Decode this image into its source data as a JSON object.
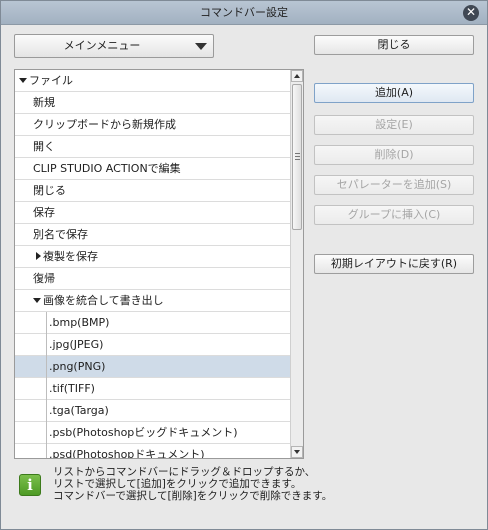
{
  "window": {
    "title": "コマンドバー設定",
    "close_icon": "close-icon"
  },
  "menu_dropdown": {
    "selected": "メインメニュー"
  },
  "buttons": {
    "close": "閉じる",
    "add": "追加(A)",
    "settings": "設定(E)",
    "delete": "削除(D)",
    "add_separator": "セパレーターを追加(S)",
    "insert_group": "グループに挿入(C)",
    "reset_layout": "初期レイアウトに戻す(R)"
  },
  "tree": {
    "items": [
      {
        "label": "ファイル",
        "type": "folder-open",
        "level": 0
      },
      {
        "label": "新規",
        "type": "item",
        "level": 1
      },
      {
        "label": "クリップボードから新規作成",
        "type": "item",
        "level": 1
      },
      {
        "label": "開く",
        "type": "item",
        "level": 1
      },
      {
        "label": "CLIP STUDIO ACTIONで編集",
        "type": "item",
        "level": 1
      },
      {
        "label": "閉じる",
        "type": "item",
        "level": 1
      },
      {
        "label": "保存",
        "type": "item",
        "level": 1
      },
      {
        "label": "別名で保存",
        "type": "item",
        "level": 1
      },
      {
        "label": "複製を保存",
        "type": "folder-closed",
        "level": 1
      },
      {
        "label": "復帰",
        "type": "item",
        "level": 1
      },
      {
        "label": "画像を統合して書き出し",
        "type": "folder-open",
        "level": 1
      },
      {
        "label": ".bmp(BMP)",
        "type": "item",
        "level": 2
      },
      {
        "label": ".jpg(JPEG)",
        "type": "item",
        "level": 2
      },
      {
        "label": ".png(PNG)",
        "type": "item",
        "level": 2,
        "selected": true
      },
      {
        "label": ".tif(TIFF)",
        "type": "item",
        "level": 2
      },
      {
        "label": ".tga(Targa)",
        "type": "item",
        "level": 2
      },
      {
        "label": ".psb(Photoshopビッグドキュメント)",
        "type": "item",
        "level": 2
      },
      {
        "label": ".psd(Photoshopドキュメント)",
        "type": "item",
        "level": 2
      }
    ]
  },
  "help": {
    "lines": [
      "リストからコマンドバーにドラッグ＆ドロップするか、",
      "リストで選択して[追加]をクリックで追加できます。",
      "コマンドバーで選択して[削除]をクリックで削除できます。"
    ],
    "icon": "info-icon"
  },
  "colors": {
    "selected_row": "#cfdbe8",
    "title_bar": "#a9b7c6",
    "info_icon": "#5fa836"
  }
}
